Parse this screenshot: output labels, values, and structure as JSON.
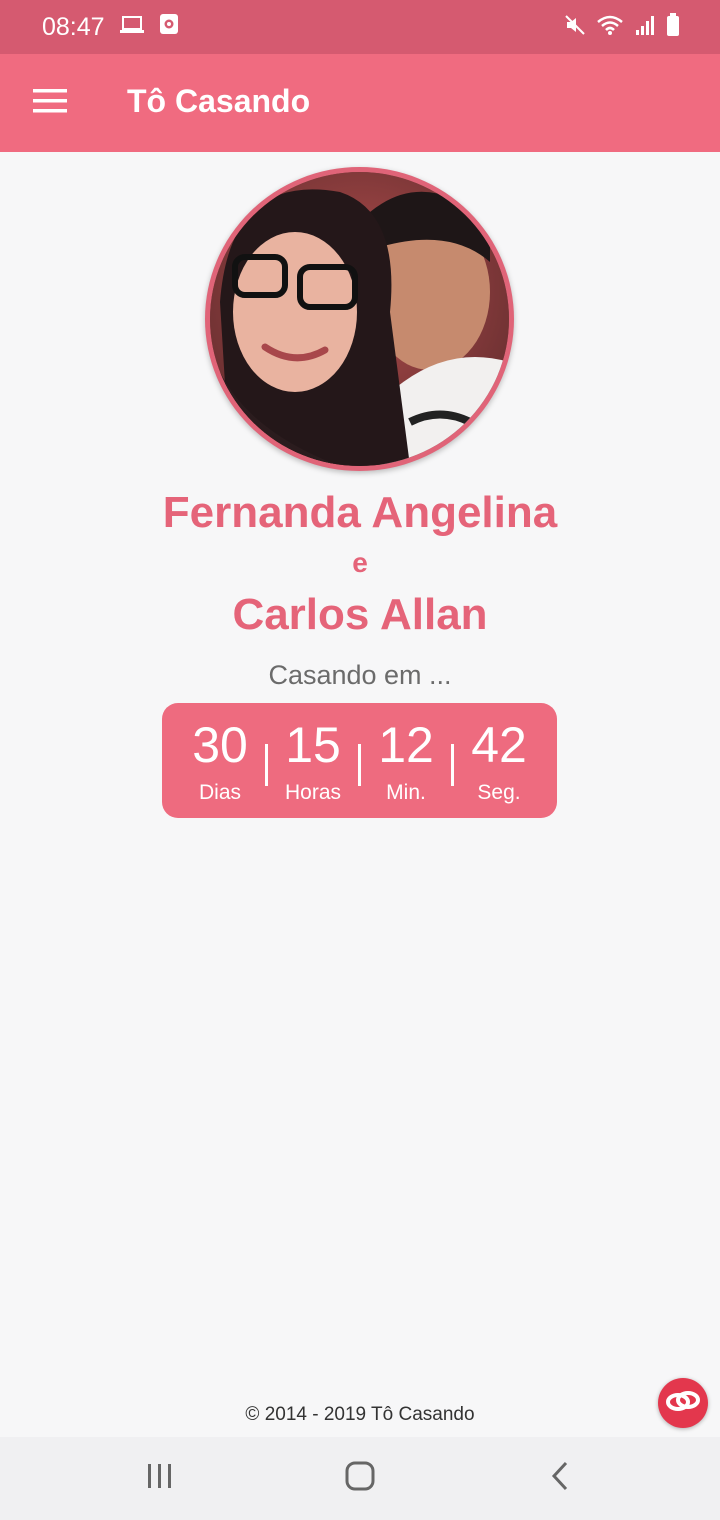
{
  "status_bar": {
    "time": "08:47"
  },
  "app_bar": {
    "title": "Tô Casando"
  },
  "couple": {
    "name1": "Fernanda Angelina",
    "conjunction": "e",
    "name2": "Carlos Allan"
  },
  "countdown": {
    "subtitle": "Casando em ...",
    "units": [
      {
        "value": "30",
        "label": "Dias"
      },
      {
        "value": "15",
        "label": "Horas"
      },
      {
        "value": "12",
        "label": "Min."
      },
      {
        "value": "42",
        "label": "Seg."
      }
    ]
  },
  "footer": {
    "text": "© 2014 - 2019 Tô Casando"
  },
  "colors": {
    "primary": "#f06b80",
    "status": "#d55a70",
    "accent_text": "#e56479",
    "fab": "#e3374d"
  }
}
